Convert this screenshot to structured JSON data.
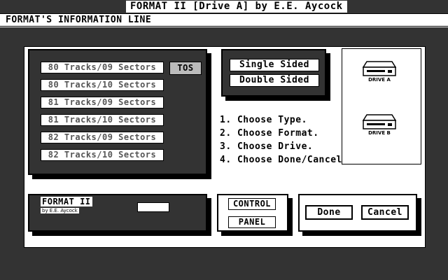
{
  "window": {
    "title": "FORMAT II [Drive A] by E.E. Aycock"
  },
  "info_line": "FORMAT'S INFORMATION LINE",
  "formats": [
    "80 Tracks/09 Sectors",
    "80 Tracks/10 Sectors",
    "81 Tracks/09 Sectors",
    "81 Tracks/10 Sectors",
    "82 Tracks/09 Sectors",
    "82 Tracks/10 Sectors"
  ],
  "tos_label": "TOS",
  "sides": {
    "single": "Single Sided",
    "double": "Double Sided"
  },
  "instructions": [
    "1. Choose Type.",
    "2. Choose Format.",
    "3. Choose Drive.",
    "4. Choose Done/Cancel"
  ],
  "drives": {
    "a": "DRIVE A",
    "b": "DRIVE B"
  },
  "credits": {
    "name": "FORMAT II",
    "by": "by E.E. Aycock"
  },
  "control_panel": {
    "control": "CONTROL",
    "panel": "PANEL"
  },
  "actions": {
    "done": "Done",
    "cancel": "Cancel"
  }
}
